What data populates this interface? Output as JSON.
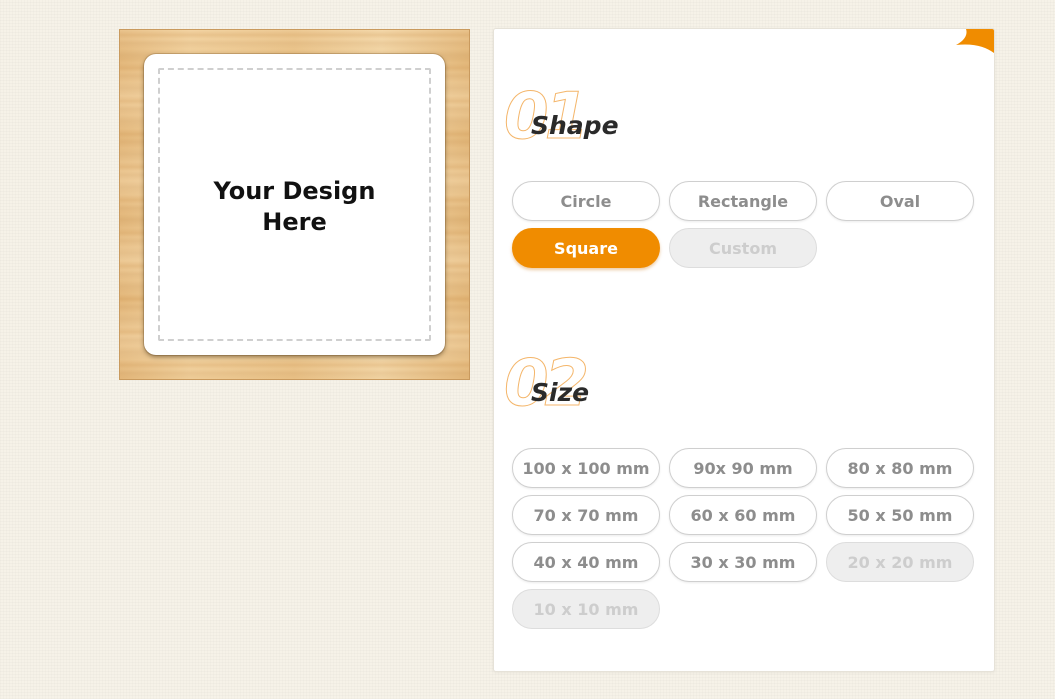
{
  "preview": {
    "design_placeholder": "Your Design\nHere"
  },
  "colors": {
    "accent": "#f08c00",
    "step_number_outline": "#f4b66b",
    "disabled_bg": "#eeeeee"
  },
  "shape_section": {
    "step_number": "01",
    "title": "Shape",
    "options": [
      {
        "label": "Circle",
        "state": "normal"
      },
      {
        "label": "Rectangle",
        "state": "normal"
      },
      {
        "label": "Oval",
        "state": "normal"
      },
      {
        "label": "Square",
        "state": "selected"
      },
      {
        "label": "Custom",
        "state": "disabled"
      }
    ]
  },
  "size_section": {
    "step_number": "02",
    "title": "Size",
    "options": [
      {
        "label": "100 x 100 mm",
        "state": "normal"
      },
      {
        "label": "90x 90 mm",
        "state": "normal"
      },
      {
        "label": "80 x 80 mm",
        "state": "normal"
      },
      {
        "label": "70 x 70 mm",
        "state": "normal"
      },
      {
        "label": "60 x 60 mm",
        "state": "normal"
      },
      {
        "label": "50 x 50 mm",
        "state": "normal"
      },
      {
        "label": "40 x 40 mm",
        "state": "normal"
      },
      {
        "label": "30 x 30 mm",
        "state": "normal"
      },
      {
        "label": "20 x 20 mm",
        "state": "disabled"
      },
      {
        "label": "10 x 10 mm",
        "state": "disabled"
      }
    ]
  }
}
